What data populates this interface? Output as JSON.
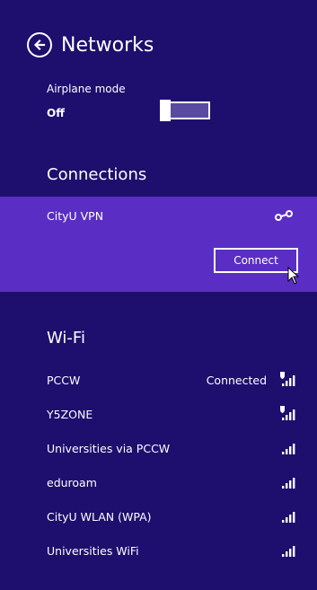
{
  "header": {
    "title": "Networks",
    "back_icon": "back-arrow-circle-icon"
  },
  "airplane": {
    "label": "Airplane mode",
    "state": "Off",
    "value": 0
  },
  "connections": {
    "heading": "Connections",
    "vpn": {
      "name": "CityU VPN",
      "icon": "vpn-icon",
      "connect_label": "Connect"
    }
  },
  "wifi": {
    "heading": "Wi-Fi",
    "networks": [
      {
        "name": "PCCW",
        "status": "Connected",
        "secured": true
      },
      {
        "name": "Y5ZONE",
        "status": "",
        "secured": true
      },
      {
        "name": "Universities via PCCW",
        "status": "",
        "secured": false
      },
      {
        "name": "eduroam",
        "status": "",
        "secured": false
      },
      {
        "name": "CityU WLAN (WPA)",
        "status": "",
        "secured": false
      },
      {
        "name": "Universities WiFi",
        "status": "",
        "secured": false
      }
    ]
  },
  "colors": {
    "background": "#1e0e6e",
    "vpn_highlight": "#5a2ec4",
    "text": "#ffffff"
  }
}
